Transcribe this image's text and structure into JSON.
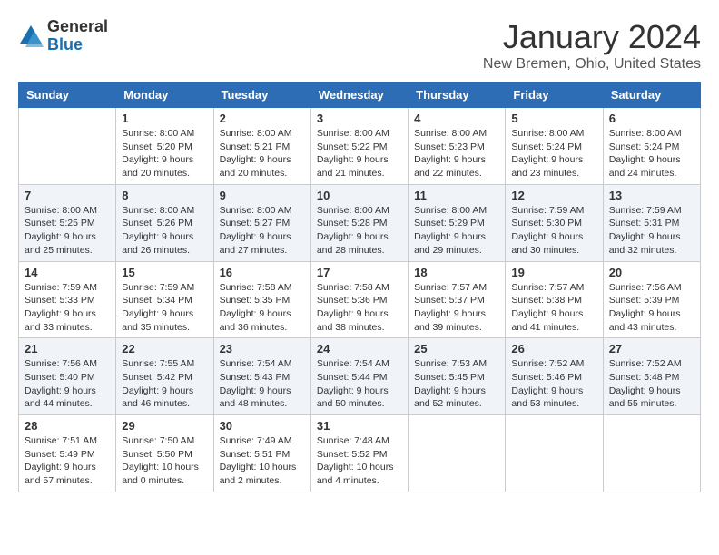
{
  "header": {
    "logo_line1": "General",
    "logo_line2": "Blue",
    "month_title": "January 2024",
    "location": "New Bremen, Ohio, United States"
  },
  "calendar": {
    "days_of_week": [
      "Sunday",
      "Monday",
      "Tuesday",
      "Wednesday",
      "Thursday",
      "Friday",
      "Saturday"
    ],
    "weeks": [
      [
        {
          "day": "",
          "info": ""
        },
        {
          "day": "1",
          "info": "Sunrise: 8:00 AM\nSunset: 5:20 PM\nDaylight: 9 hours\nand 20 minutes."
        },
        {
          "day": "2",
          "info": "Sunrise: 8:00 AM\nSunset: 5:21 PM\nDaylight: 9 hours\nand 20 minutes."
        },
        {
          "day": "3",
          "info": "Sunrise: 8:00 AM\nSunset: 5:22 PM\nDaylight: 9 hours\nand 21 minutes."
        },
        {
          "day": "4",
          "info": "Sunrise: 8:00 AM\nSunset: 5:23 PM\nDaylight: 9 hours\nand 22 minutes."
        },
        {
          "day": "5",
          "info": "Sunrise: 8:00 AM\nSunset: 5:24 PM\nDaylight: 9 hours\nand 23 minutes."
        },
        {
          "day": "6",
          "info": "Sunrise: 8:00 AM\nSunset: 5:24 PM\nDaylight: 9 hours\nand 24 minutes."
        }
      ],
      [
        {
          "day": "7",
          "info": "Sunrise: 8:00 AM\nSunset: 5:25 PM\nDaylight: 9 hours\nand 25 minutes."
        },
        {
          "day": "8",
          "info": "Sunrise: 8:00 AM\nSunset: 5:26 PM\nDaylight: 9 hours\nand 26 minutes."
        },
        {
          "day": "9",
          "info": "Sunrise: 8:00 AM\nSunset: 5:27 PM\nDaylight: 9 hours\nand 27 minutes."
        },
        {
          "day": "10",
          "info": "Sunrise: 8:00 AM\nSunset: 5:28 PM\nDaylight: 9 hours\nand 28 minutes."
        },
        {
          "day": "11",
          "info": "Sunrise: 8:00 AM\nSunset: 5:29 PM\nDaylight: 9 hours\nand 29 minutes."
        },
        {
          "day": "12",
          "info": "Sunrise: 7:59 AM\nSunset: 5:30 PM\nDaylight: 9 hours\nand 30 minutes."
        },
        {
          "day": "13",
          "info": "Sunrise: 7:59 AM\nSunset: 5:31 PM\nDaylight: 9 hours\nand 32 minutes."
        }
      ],
      [
        {
          "day": "14",
          "info": "Sunrise: 7:59 AM\nSunset: 5:33 PM\nDaylight: 9 hours\nand 33 minutes."
        },
        {
          "day": "15",
          "info": "Sunrise: 7:59 AM\nSunset: 5:34 PM\nDaylight: 9 hours\nand 35 minutes."
        },
        {
          "day": "16",
          "info": "Sunrise: 7:58 AM\nSunset: 5:35 PM\nDaylight: 9 hours\nand 36 minutes."
        },
        {
          "day": "17",
          "info": "Sunrise: 7:58 AM\nSunset: 5:36 PM\nDaylight: 9 hours\nand 38 minutes."
        },
        {
          "day": "18",
          "info": "Sunrise: 7:57 AM\nSunset: 5:37 PM\nDaylight: 9 hours\nand 39 minutes."
        },
        {
          "day": "19",
          "info": "Sunrise: 7:57 AM\nSunset: 5:38 PM\nDaylight: 9 hours\nand 41 minutes."
        },
        {
          "day": "20",
          "info": "Sunrise: 7:56 AM\nSunset: 5:39 PM\nDaylight: 9 hours\nand 43 minutes."
        }
      ],
      [
        {
          "day": "21",
          "info": "Sunrise: 7:56 AM\nSunset: 5:40 PM\nDaylight: 9 hours\nand 44 minutes."
        },
        {
          "day": "22",
          "info": "Sunrise: 7:55 AM\nSunset: 5:42 PM\nDaylight: 9 hours\nand 46 minutes."
        },
        {
          "day": "23",
          "info": "Sunrise: 7:54 AM\nSunset: 5:43 PM\nDaylight: 9 hours\nand 48 minutes."
        },
        {
          "day": "24",
          "info": "Sunrise: 7:54 AM\nSunset: 5:44 PM\nDaylight: 9 hours\nand 50 minutes."
        },
        {
          "day": "25",
          "info": "Sunrise: 7:53 AM\nSunset: 5:45 PM\nDaylight: 9 hours\nand 52 minutes."
        },
        {
          "day": "26",
          "info": "Sunrise: 7:52 AM\nSunset: 5:46 PM\nDaylight: 9 hours\nand 53 minutes."
        },
        {
          "day": "27",
          "info": "Sunrise: 7:52 AM\nSunset: 5:48 PM\nDaylight: 9 hours\nand 55 minutes."
        }
      ],
      [
        {
          "day": "28",
          "info": "Sunrise: 7:51 AM\nSunset: 5:49 PM\nDaylight: 9 hours\nand 57 minutes."
        },
        {
          "day": "29",
          "info": "Sunrise: 7:50 AM\nSunset: 5:50 PM\nDaylight: 10 hours\nand 0 minutes."
        },
        {
          "day": "30",
          "info": "Sunrise: 7:49 AM\nSunset: 5:51 PM\nDaylight: 10 hours\nand 2 minutes."
        },
        {
          "day": "31",
          "info": "Sunrise: 7:48 AM\nSunset: 5:52 PM\nDaylight: 10 hours\nand 4 minutes."
        },
        {
          "day": "",
          "info": ""
        },
        {
          "day": "",
          "info": ""
        },
        {
          "day": "",
          "info": ""
        }
      ]
    ]
  }
}
